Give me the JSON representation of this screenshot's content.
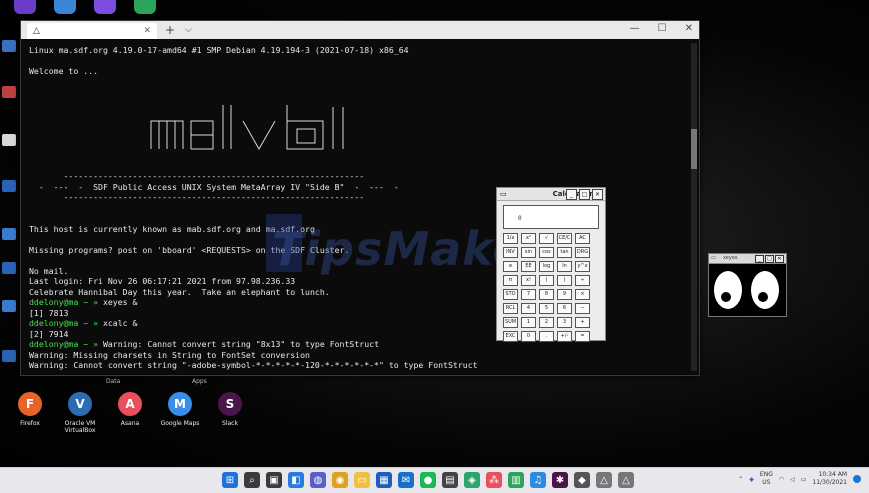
{
  "terminal": {
    "tab_label": "",
    "lines": [
      "Linux ma.sdf.org 4.19.0-17-amd64 #1 SMP Debian 4.19.194-3 (2021-07-18) x86_64",
      "",
      "Welcome to ...",
      "",
      "",
      "",
      "",
      "",
      "",
      "",
      "",
      "",
      "       -------------------------------------------------------------",
      "  -  ---  -  SDF Public Access UNIX System MetaArray IV \"Side B\"  -  ---  -",
      "       -------------------------------------------------------------",
      "",
      "",
      "This host is currently known as mab.sdf.org and ma.sdf.org",
      "",
      "Missing programs? post on 'bboard' <REQUESTS> on the SDF Cluster.",
      "",
      "No mail.",
      "Last login: Fri Nov 26 06:17:21 2021 from 97.98.236.33",
      "Celebrate Hannibal Day this year.  Take an elephant to lunch."
    ],
    "session": [
      {
        "prompt": "ddelony@ma",
        "arrow": " ~ » ",
        "cmd": "xeyes &"
      },
      {
        "out": "[1] 7813"
      },
      {
        "prompt": "ddelony@ma",
        "arrow": " ~ » ",
        "cmd": "xcalc &"
      },
      {
        "out": "[2] 7914"
      },
      {
        "prompt": "ddelony@ma",
        "arrow": " ~ » ",
        "cmd": "Warning: Cannot convert string \"8x13\" to type FontStruct"
      },
      {
        "out": "Warning: Missing charsets in String to FontSet conversion"
      },
      {
        "out": "Warning: Cannot convert string \"-adobe-symbol-*-*-*-*-*-120-*-*-*-*-*-*\" to type FontStruct"
      }
    ]
  },
  "calculator": {
    "title": "Calculator",
    "display": "0",
    "keys": [
      "1/x",
      "x²",
      "√",
      "CE/C",
      "AC",
      "INV",
      "sin",
      "cos",
      "tan",
      "DRG",
      "e",
      "EE",
      "log",
      "ln",
      "y^x",
      "π",
      "x!",
      "(",
      ")",
      "÷",
      "STO",
      "7",
      "8",
      "9",
      "×",
      "RCL",
      "4",
      "5",
      "6",
      "−",
      "SUM",
      "1",
      "2",
      "3",
      "+",
      "EXC",
      "0",
      ".",
      "+/-",
      "="
    ]
  },
  "xeyes": {
    "title": "xeyes"
  },
  "desktop": {
    "group_labels": [
      "Data",
      "Apps"
    ],
    "apps": [
      {
        "label": "Firefox",
        "color": "#e8632a",
        "glyph": "F"
      },
      {
        "label": "Oracle VM VirtualBox",
        "color": "#2d6cb0",
        "glyph": "V"
      },
      {
        "label": "Asana",
        "color": "#e8505b",
        "glyph": "A"
      },
      {
        "label": "Google Maps",
        "color": "#3a8ee8",
        "glyph": "M"
      },
      {
        "label": "Slack",
        "color": "#4a154b",
        "glyph": "S"
      }
    ]
  },
  "watermark": "TipsMake",
  "taskbar": {
    "icons": [
      {
        "name": "windows-start-icon",
        "color": "#1e73d8",
        "glyph": "⊞"
      },
      {
        "name": "search-icon",
        "color": "#3b3b3b",
        "glyph": "⌕"
      },
      {
        "name": "task-view-icon",
        "color": "#3a3a3a",
        "glyph": "▣"
      },
      {
        "name": "widgets-icon",
        "color": "#2a7be0",
        "glyph": "◧"
      },
      {
        "name": "chat-icon",
        "color": "#5b5fc7",
        "glyph": "◍"
      },
      {
        "name": "chrome-icon",
        "color": "#e0a020",
        "glyph": "◉"
      },
      {
        "name": "file-explorer-icon",
        "color": "#f0c040",
        "glyph": "▭"
      },
      {
        "name": "store-icon",
        "color": "#1c5fb8",
        "glyph": "▦"
      },
      {
        "name": "mail-icon",
        "color": "#1a6fc9",
        "glyph": "✉"
      },
      {
        "name": "spotify-icon",
        "color": "#1db954",
        "glyph": "●"
      },
      {
        "name": "terminal-app-icon",
        "color": "#444",
        "glyph": "▤"
      },
      {
        "name": "maps-app-icon",
        "color": "#2ea36b",
        "glyph": "◈"
      },
      {
        "name": "asana-app-icon",
        "color": "#e8505b",
        "glyph": "⁂"
      },
      {
        "name": "sheets-icon",
        "color": "#2aa55a",
        "glyph": "▥"
      },
      {
        "name": "music-icon",
        "color": "#2a8be0",
        "glyph": "♫"
      },
      {
        "name": "slack-app-icon",
        "color": "#4a154b",
        "glyph": "✱"
      },
      {
        "name": "linux-icon",
        "color": "#555",
        "glyph": "◆"
      },
      {
        "name": "warning-app-icon",
        "color": "#777",
        "glyph": "△"
      },
      {
        "name": "warning-app-icon-2",
        "color": "#777",
        "glyph": "△"
      }
    ],
    "lang_top": "ENG",
    "lang_bottom": "US",
    "time": "10:34 AM",
    "date": "11/30/2021"
  }
}
